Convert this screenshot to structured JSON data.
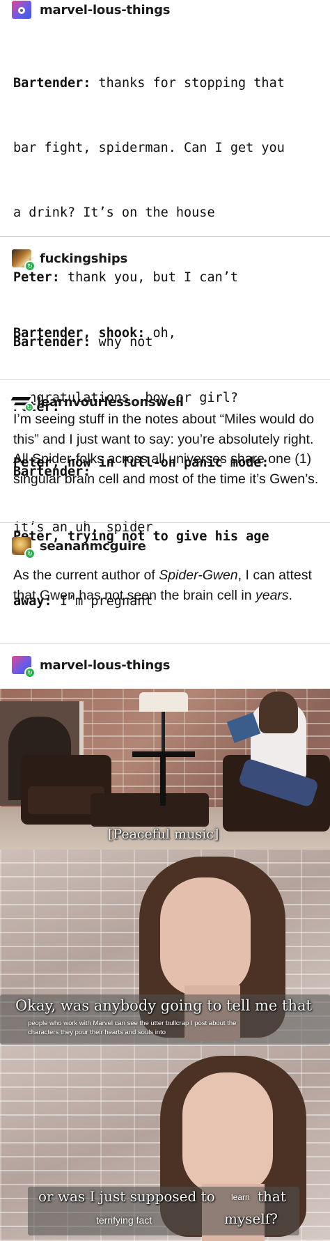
{
  "post1": {
    "username": "marvel-lous-things",
    "lines": [
      {
        "speaker": "Bartender:",
        "text": " thanks for stopping that"
      },
      {
        "speaker": "",
        "text": "bar fight, spiderman. Can I get you"
      },
      {
        "speaker": "",
        "text": "a drink? It’s on the house"
      },
      {
        "speaker": "Peter:",
        "text": " thank you, but I can’t"
      },
      {
        "speaker": "Bartender:",
        "text": " why not"
      },
      {
        "speaker": "Peter:",
        "text": ""
      },
      {
        "speaker": "Bartender:",
        "text": ""
      },
      {
        "speaker": "Peter, trying not to give his age",
        "text": ""
      },
      {
        "speaker": "away:",
        "text": " I’m pregnant"
      }
    ]
  },
  "post2": {
    "username": "fuckingships",
    "lines": [
      {
        "speaker": "Bartender, shook:",
        "text": " oh,"
      },
      {
        "speaker": "",
        "text": "congratulations, boy or girl?"
      },
      {
        "speaker": "Peter, now in full-on panic mode:",
        "text": ""
      },
      {
        "speaker": "",
        "text": "it’s an uh, spider"
      }
    ]
  },
  "post3": {
    "username": "learnvourlessonswell",
    "body": "I’m seeing stuff in the notes about “Miles would do this” and I just want to say: you’re absolutely right. All Spider-folks across all universes share one (1) singular brain cell and most of the time it’s Gwen’s."
  },
  "post4": {
    "username": "seananmcguire",
    "body_pre": "As the current author of ",
    "body_italic": "Spider-Gwen",
    "body_mid": ", I can attest that Gwen has not seen the brain cell in ",
    "body_italic2": "years",
    "body_post": "."
  },
  "post5": {
    "username": "marvel-lous-things",
    "panel1_caption": "[Peaceful music]",
    "panel2_caption": "Okay, was anybody going to tell me that",
    "panel2_sub1": "people who work with Marvel can see the utter bullcrap I post about the",
    "panel2_sub2": "characters they pour their hearts and souls into",
    "panel3_caption_a": "or was I just supposed to",
    "panel3_small_a": "learn",
    "panel3_caption_b": "that",
    "panel3_small_b": "terrifying fact",
    "panel3_caption_c": "myself?"
  },
  "colors": {
    "divider": "#d6d6d6",
    "reblog_green": "#2eb150",
    "avatar_blue": "#3b5bdb",
    "avatar_pink": "#e84393"
  }
}
